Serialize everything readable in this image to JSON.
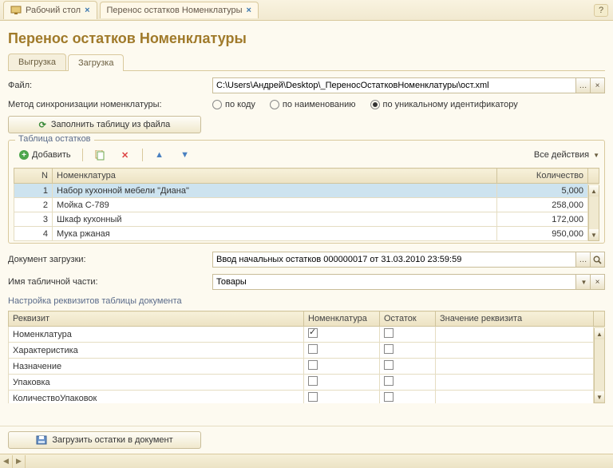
{
  "topTabs": {
    "desktop": "Рабочий стол",
    "current": "Перенос остатков Номенклатуры"
  },
  "pageTitle": "Перенос остатков Номенклатуры",
  "subTabs": {
    "export": "Выгрузка",
    "import": "Загрузка"
  },
  "fileRow": {
    "label": "Файл:",
    "value": "C:\\Users\\Андрей\\Desktop\\_ПереносОстатковНоменклатуры\\ост.xml"
  },
  "syncRow": {
    "label": "Метод синхронизации номенклатуры:",
    "options": {
      "byCode": "по коду",
      "byName": "по наименованию",
      "byUid": "по уникальному идентификатору"
    },
    "selected": "byUid"
  },
  "fillBtn": "Заполнить таблицу из файла",
  "balancesGroup": {
    "title": "Таблица остатков",
    "addBtn": "Добавить",
    "allActions": "Все действия",
    "columns": {
      "n": "N",
      "nomen": "Номенклатура",
      "qty": "Количество"
    },
    "rows": [
      {
        "n": "1",
        "nomen": "Набор кухонной мебели \"Диана\"",
        "qty": "5,000"
      },
      {
        "n": "2",
        "nomen": "Мойка С-789",
        "qty": "258,000"
      },
      {
        "n": "3",
        "nomen": "Шкаф кухонный",
        "qty": "172,000"
      },
      {
        "n": "4",
        "nomen": "Мука ржаная",
        "qty": "950,000"
      }
    ]
  },
  "docRow": {
    "label": "Документ загрузки:",
    "value": "Ввод начальных остатков 000000017 от 31.03.2010 23:59:59"
  },
  "tabPartRow": {
    "label": "Имя табличной части:",
    "value": "Товары"
  },
  "attrSection": {
    "title": "Настройка реквизитов таблицы документа",
    "columns": {
      "req": "Реквизит",
      "nomen": "Номенклатура",
      "ost": "Остаток",
      "val": "Значение реквизита"
    },
    "rows": [
      {
        "req": "Номенклатура",
        "nomen": true,
        "ost": false
      },
      {
        "req": "Характеристика",
        "nomen": false,
        "ost": false
      },
      {
        "req": "Назначение",
        "nomen": false,
        "ost": false
      },
      {
        "req": "Упаковка",
        "nomen": false,
        "ost": false
      },
      {
        "req": "КоличествоУпаковок",
        "nomen": false,
        "ost": false
      }
    ]
  },
  "loadBtn": "Загрузить остатки в документ"
}
